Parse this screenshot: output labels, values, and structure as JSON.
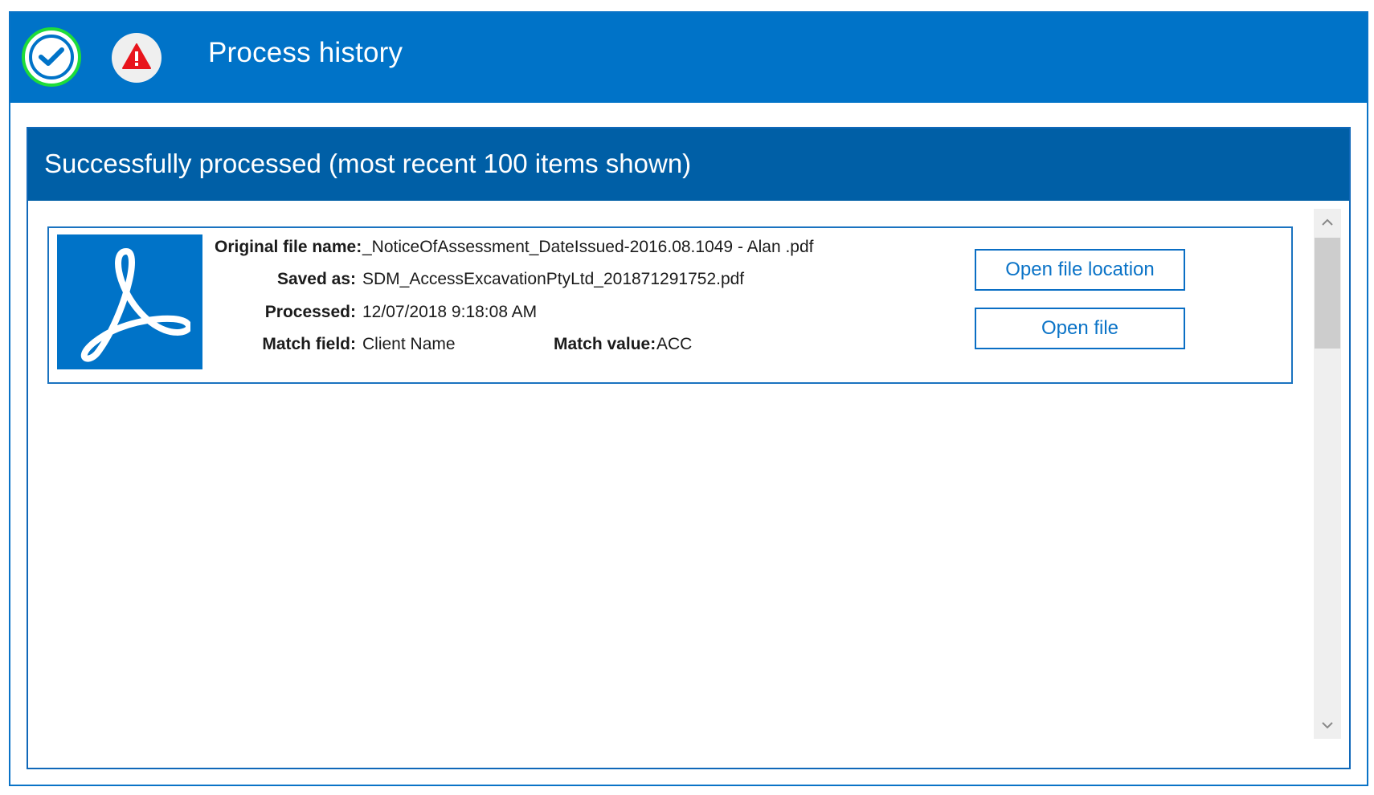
{
  "window": {
    "title": "Process history"
  },
  "toolbar": {
    "success_icon": "check-circle-icon",
    "warning_icon": "warning-triangle-icon",
    "success_ring_color": "#1edc3a",
    "accent_color": "#0073c8",
    "warning_color": "#e8141c"
  },
  "panel": {
    "title": "Successfully processed (most recent 100 items shown)",
    "header_color": "#005fa6"
  },
  "items": [
    {
      "icon": "pdf-document-icon",
      "original_file_name_label": "Original file name:",
      "original_file_name": "_NoticeOfAssessment_DateIssued-2016.08.1049 - Alan .pdf",
      "saved_as_label": "Saved as:",
      "saved_as": "SDM_AccessExcavationPtyLtd_201871291752.pdf",
      "processed_label": "Processed:",
      "processed": "12/07/2018 9:18:08 AM",
      "match_field_label": "Match field:",
      "match_field": "Client Name",
      "match_value_label": "Match value:",
      "match_value": "ACC",
      "open_location_label": "Open file location",
      "open_file_label": "Open file"
    }
  ],
  "scrollbar": {
    "up_icon": "chevron-up-icon",
    "down_icon": "chevron-down-icon"
  }
}
